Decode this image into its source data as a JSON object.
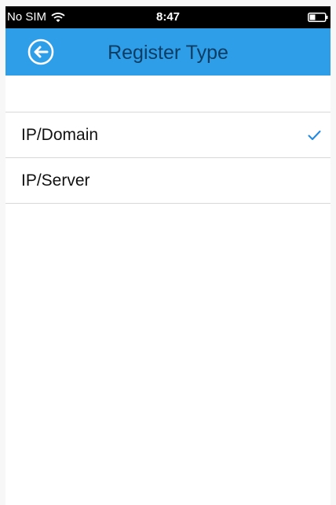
{
  "status_bar": {
    "carrier": "No SIM",
    "time": "8:47",
    "wifi_icon": "wifi-icon",
    "battery_icon": "battery-icon"
  },
  "nav_bar": {
    "title": "Register Type",
    "back_icon": "arrow-left-circle-icon",
    "background_color": "#2f9ee9"
  },
  "list": {
    "items": [
      {
        "label": "IP/Domain",
        "selected": true
      },
      {
        "label": "IP/Server",
        "selected": false
      }
    ],
    "check_color": "#1e88e5"
  }
}
